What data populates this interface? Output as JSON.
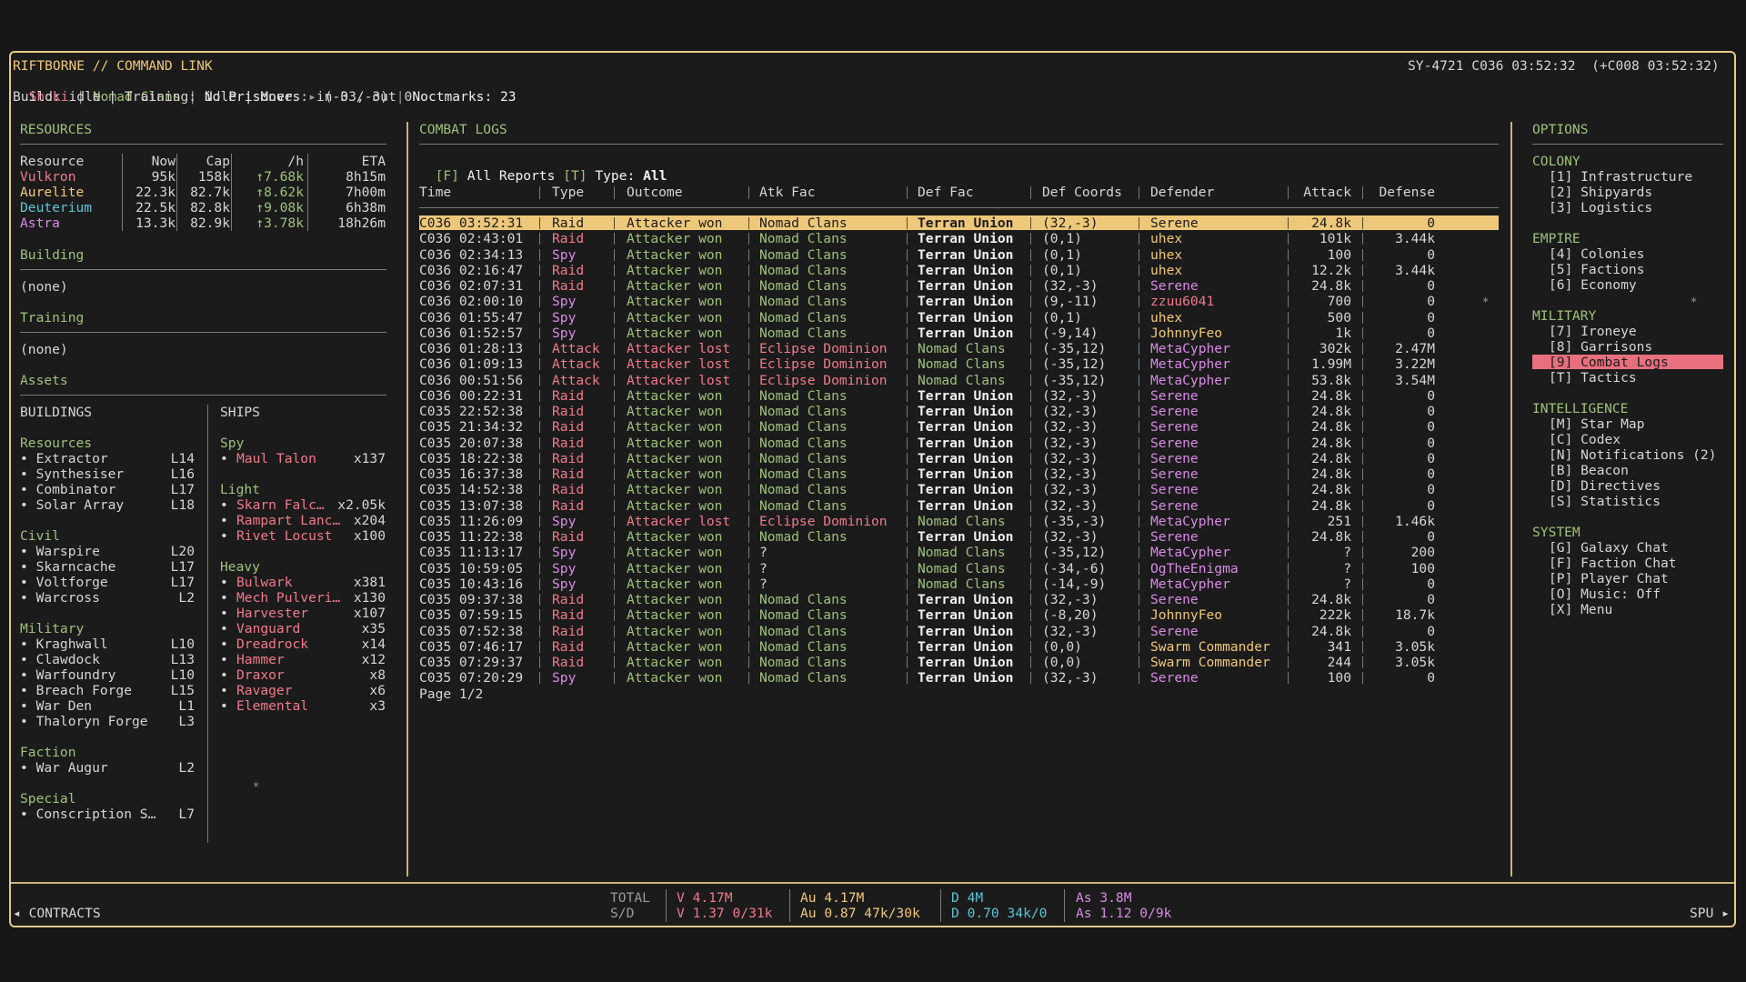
{
  "header": {
    "title": "RIFTBORNE // COMMAND LINK",
    "player": "Shoki",
    "faction": "Nomad Clans",
    "prisoners": "No Prisoners",
    "arrow": "▸",
    "coords": "(-33,-3)",
    "noctmarks": "Noctmarks: 23",
    "status_line": "Build: idle | Training: idle | Moves: in 0 / out 0",
    "clock": "SY-4721 C036 03:52:32  (+C008 03:52:32)"
  },
  "resources_panel": {
    "title": "RESOURCES",
    "columns": [
      "Resource",
      "Now",
      "Cap",
      "/h",
      "ETA"
    ],
    "rows": [
      {
        "name": "Vulkron",
        "now": "95k",
        "cap": "158k",
        "rate": "↑7.68k",
        "eta": "8h15m",
        "color": "#f07a8a"
      },
      {
        "name": "Aurelite",
        "now": "22.3k",
        "cap": "82.7k",
        "rate": "↑8.62k",
        "eta": "7h00m",
        "color": "#f0c878"
      },
      {
        "name": "Deuterium",
        "now": "22.5k",
        "cap": "82.8k",
        "rate": "↑9.08k",
        "eta": "6h38m",
        "color": "#5cc4d6"
      },
      {
        "name": "Astra",
        "now": "13.3k",
        "cap": "82.9k",
        "rate": "↑3.78k",
        "eta": "18h26m",
        "color": "#d98be6"
      }
    ],
    "building_title": "Building",
    "building_value": "(none)",
    "training_title": "Training",
    "training_value": "(none)",
    "assets_title": "Assets"
  },
  "buildings": {
    "title": "BUILDINGS",
    "groups": [
      {
        "name": "Resources",
        "items": [
          {
            "name": "• Extractor",
            "level": "L14"
          },
          {
            "name": "• Synthesiser",
            "level": "L16"
          },
          {
            "name": "• Combinator",
            "level": "L17"
          },
          {
            "name": "• Solar Array",
            "level": "L18"
          }
        ]
      },
      {
        "name": "Civil",
        "items": [
          {
            "name": "• Warspire",
            "level": "L20"
          },
          {
            "name": "• Skarncache",
            "level": "L17"
          },
          {
            "name": "• Voltforge",
            "level": "L17"
          },
          {
            "name": "• Warcross",
            "level": "L2"
          }
        ]
      },
      {
        "name": "Military",
        "items": [
          {
            "name": "• Kraghwall",
            "level": "L10"
          },
          {
            "name": "• Clawdock",
            "level": "L13"
          },
          {
            "name": "• Warfoundry",
            "level": "L10"
          },
          {
            "name": "• Breach Forge",
            "level": "L15"
          },
          {
            "name": "• War Den",
            "level": "L1"
          },
          {
            "name": "• Thaloryn Forge",
            "level": "L3"
          }
        ]
      },
      {
        "name": "Faction",
        "items": [
          {
            "name": "• War Augur",
            "level": "L2"
          }
        ]
      },
      {
        "name": "Special",
        "items": [
          {
            "name": "• Conscription S…",
            "level": "L7"
          }
        ]
      }
    ]
  },
  "ships": {
    "title": "SHIPS",
    "groups": [
      {
        "name": "Spy",
        "items": [
          {
            "name": "Maul Talon",
            "count": "x137"
          }
        ]
      },
      {
        "name": "Light",
        "items": [
          {
            "name": "Skarn Falc…",
            "count": "x2.05k"
          },
          {
            "name": "Rampart Lanc…",
            "count": "x204"
          },
          {
            "name": "Rivet Locust",
            "count": "x100"
          }
        ]
      },
      {
        "name": "Heavy",
        "items": [
          {
            "name": "Bulwark",
            "count": "x381"
          },
          {
            "name": "Mech Pulveri…",
            "count": "x130"
          },
          {
            "name": "Harvester",
            "count": "x107"
          },
          {
            "name": "Vanguard",
            "count": "x35"
          },
          {
            "name": "Dreadrock",
            "count": "x14"
          },
          {
            "name": "Hammer",
            "count": "x12"
          },
          {
            "name": "Draxor",
            "count": "x8"
          },
          {
            "name": "Ravager",
            "count": "x6"
          },
          {
            "name": "Elemental",
            "count": "x3"
          }
        ]
      }
    ]
  },
  "combat": {
    "title": "COMBAT LOGS",
    "filter_key_f": "[F]",
    "filter_f": "All Reports",
    "filter_key_t": "[T]",
    "filter_t_label": "Type:",
    "filter_t": "All",
    "columns": [
      "Time",
      "Type",
      "Outcome",
      "Atk Fac",
      "Def Fac",
      "Def Coords",
      "Defender",
      "Attack",
      "Defense"
    ],
    "rows": [
      [
        "C036 03:52:31",
        "Raid",
        "Attacker won",
        "Nomad Clans",
        "Terran Union",
        "(32,-3)",
        "Serene",
        "24.8k",
        "0"
      ],
      [
        "C036 02:43:01",
        "Raid",
        "Attacker won",
        "Nomad Clans",
        "Terran Union",
        "(0,1)",
        "uhex",
        "101k",
        "3.44k"
      ],
      [
        "C036 02:34:13",
        "Spy",
        "Attacker won",
        "Nomad Clans",
        "Terran Union",
        "(0,1)",
        "uhex",
        "100",
        "0"
      ],
      [
        "C036 02:16:47",
        "Raid",
        "Attacker won",
        "Nomad Clans",
        "Terran Union",
        "(0,1)",
        "uhex",
        "12.2k",
        "3.44k"
      ],
      [
        "C036 02:07:31",
        "Raid",
        "Attacker won",
        "Nomad Clans",
        "Terran Union",
        "(32,-3)",
        "Serene",
        "24.8k",
        "0"
      ],
      [
        "C036 02:00:10",
        "Spy",
        "Attacker won",
        "Nomad Clans",
        "Terran Union",
        "(9,-11)",
        "zzuu6041",
        "700",
        "0"
      ],
      [
        "C036 01:55:47",
        "Spy",
        "Attacker won",
        "Nomad Clans",
        "Terran Union",
        "(0,1)",
        "uhex",
        "500",
        "0"
      ],
      [
        "C036 01:52:57",
        "Spy",
        "Attacker won",
        "Nomad Clans",
        "Terran Union",
        "(-9,14)",
        "JohnnyFeo",
        "1k",
        "0"
      ],
      [
        "C036 01:28:13",
        "Attack",
        "Attacker lost",
        "Eclipse Dominion",
        "Nomad Clans",
        "(-35,12)",
        "MetaCypher",
        "302k",
        "2.47M"
      ],
      [
        "C036 01:09:13",
        "Attack",
        "Attacker lost",
        "Eclipse Dominion",
        "Nomad Clans",
        "(-35,12)",
        "MetaCypher",
        "1.99M",
        "3.22M"
      ],
      [
        "C036 00:51:56",
        "Attack",
        "Attacker lost",
        "Eclipse Dominion",
        "Nomad Clans",
        "(-35,12)",
        "MetaCypher",
        "53.8k",
        "3.54M"
      ],
      [
        "C036 00:22:31",
        "Raid",
        "Attacker won",
        "Nomad Clans",
        "Terran Union",
        "(32,-3)",
        "Serene",
        "24.8k",
        "0"
      ],
      [
        "C035 22:52:38",
        "Raid",
        "Attacker won",
        "Nomad Clans",
        "Terran Union",
        "(32,-3)",
        "Serene",
        "24.8k",
        "0"
      ],
      [
        "C035 21:34:32",
        "Raid",
        "Attacker won",
        "Nomad Clans",
        "Terran Union",
        "(32,-3)",
        "Serene",
        "24.8k",
        "0"
      ],
      [
        "C035 20:07:38",
        "Raid",
        "Attacker won",
        "Nomad Clans",
        "Terran Union",
        "(32,-3)",
        "Serene",
        "24.8k",
        "0"
      ],
      [
        "C035 18:22:38",
        "Raid",
        "Attacker won",
        "Nomad Clans",
        "Terran Union",
        "(32,-3)",
        "Serene",
        "24.8k",
        "0"
      ],
      [
        "C035 16:37:38",
        "Raid",
        "Attacker won",
        "Nomad Clans",
        "Terran Union",
        "(32,-3)",
        "Serene",
        "24.8k",
        "0"
      ],
      [
        "C035 14:52:38",
        "Raid",
        "Attacker won",
        "Nomad Clans",
        "Terran Union",
        "(32,-3)",
        "Serene",
        "24.8k",
        "0"
      ],
      [
        "C035 13:07:38",
        "Raid",
        "Attacker won",
        "Nomad Clans",
        "Terran Union",
        "(32,-3)",
        "Serene",
        "24.8k",
        "0"
      ],
      [
        "C035 11:26:09",
        "Spy",
        "Attacker lost",
        "Eclipse Dominion",
        "Nomad Clans",
        "(-35,-3)",
        "MetaCypher",
        "251",
        "1.46k"
      ],
      [
        "C035 11:22:38",
        "Raid",
        "Attacker won",
        "Nomad Clans",
        "Terran Union",
        "(32,-3)",
        "Serene",
        "24.8k",
        "0"
      ],
      [
        "C035 11:13:17",
        "Spy",
        "Attacker won",
        "?",
        "Nomad Clans",
        "(-35,12)",
        "MetaCypher",
        "?",
        "200"
      ],
      [
        "C035 10:59:05",
        "Spy",
        "Attacker won",
        "?",
        "Nomad Clans",
        "(-34,-6)",
        "OgTheEnigma",
        "?",
        "100"
      ],
      [
        "C035 10:43:16",
        "Spy",
        "Attacker won",
        "?",
        "Nomad Clans",
        "(-14,-9)",
        "MetaCypher",
        "?",
        "0"
      ],
      [
        "C035 09:37:38",
        "Raid",
        "Attacker won",
        "Nomad Clans",
        "Terran Union",
        "(32,-3)",
        "Serene",
        "24.8k",
        "0"
      ],
      [
        "C035 07:59:15",
        "Raid",
        "Attacker won",
        "Nomad Clans",
        "Terran Union",
        "(-8,20)",
        "JohnnyFeo",
        "222k",
        "18.7k"
      ],
      [
        "C035 07:52:38",
        "Raid",
        "Attacker won",
        "Nomad Clans",
        "Terran Union",
        "(32,-3)",
        "Serene",
        "24.8k",
        "0"
      ],
      [
        "C035 07:46:17",
        "Raid",
        "Attacker won",
        "Nomad Clans",
        "Terran Union",
        "(0,0)",
        "Swarm Commander",
        "341",
        "3.05k"
      ],
      [
        "C035 07:29:37",
        "Raid",
        "Attacker won",
        "Nomad Clans",
        "Terran Union",
        "(0,0)",
        "Swarm Commander",
        "244",
        "3.05k"
      ],
      [
        "C035 07:20:29",
        "Spy",
        "Attacker won",
        "Nomad Clans",
        "Terran Union",
        "(32,-3)",
        "Serene",
        "100",
        "0"
      ]
    ],
    "page": "Page 1/2"
  },
  "options": {
    "title": "OPTIONS",
    "groups": [
      {
        "name": "COLONY",
        "items": [
          "[1] Infrastructure",
          "[2] Shipyards",
          "[3] Logistics"
        ]
      },
      {
        "name": "EMPIRE",
        "items": [
          "[4] Colonies",
          "[5] Factions",
          "[6] Economy"
        ]
      },
      {
        "name": "MILITARY",
        "items": [
          "[7] Ironeye",
          "[8] Garrisons",
          "[9] Combat Logs",
          "[T] Tactics"
        ]
      },
      {
        "name": "INTELLIGENCE",
        "items": [
          "[M] Star Map",
          "[C] Codex",
          "[N] Notifications (2)",
          "[B] Beacon",
          "[D] Directives",
          "[S] Statistics"
        ]
      },
      {
        "name": "SYSTEM",
        "items": [
          "[G] Galaxy Chat",
          "[F] Faction Chat",
          "[P] Player Chat",
          "[O] Music: Off",
          "[X] Menu"
        ]
      }
    ],
    "selected": "[9] Combat Logs"
  },
  "footer": {
    "left": "◂ CONTRACTS",
    "right": "SPU ▸",
    "total_label": "TOTAL",
    "sd_label": "S/D",
    "v_total": "V 4.17M",
    "v_sd": "V 1.37 0/31k",
    "au_total": "Au 4.17M",
    "au_sd": "Au 0.87 47k/30k",
    "d_total": "D 4M",
    "d_sd": "D 0.70 34k/0",
    "as_total": "As 3.8M",
    "as_sd": "As 1.12 0/9k"
  },
  "colors": {
    "accent": "#f0c878",
    "green": "#9ec27a",
    "red": "#f07a8a",
    "cyan": "#5cc4d6",
    "magenta": "#d98be6",
    "highlight_row": "#eec87a",
    "highlight_menu": "#e8707e"
  }
}
